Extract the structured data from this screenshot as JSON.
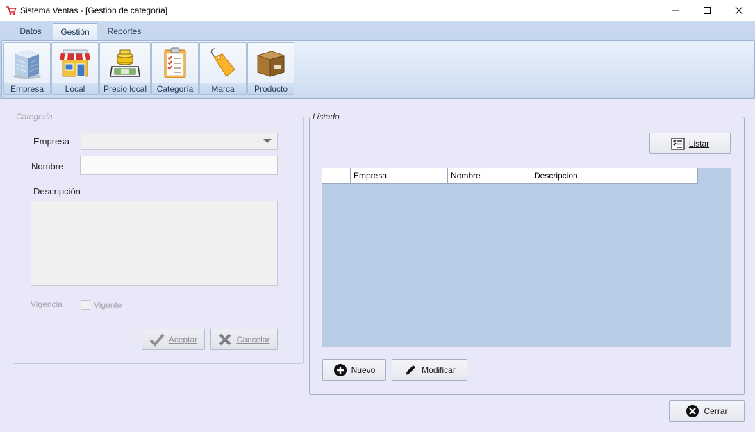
{
  "window": {
    "title": "Sistema Ventas - [Gestión de categoría]",
    "controls": [
      "minimize-icon",
      "maximize-icon",
      "close-icon"
    ]
  },
  "ribbon": {
    "tabs": [
      {
        "label": "Datos",
        "active": false
      },
      {
        "label": "Gestión",
        "active": true
      },
      {
        "label": "Reportes",
        "active": false
      }
    ],
    "buttons": [
      {
        "label": "Empresa",
        "icon": "building-icon"
      },
      {
        "label": "Local",
        "icon": "store-icon"
      },
      {
        "label": "Precio local",
        "icon": "price-cash-icon"
      },
      {
        "label": "Categoría",
        "icon": "clipboard-checklist-icon"
      },
      {
        "label": "Marca",
        "icon": "tag-icon"
      },
      {
        "label": "Producto",
        "icon": "box-icon"
      }
    ]
  },
  "categoria": {
    "legend": "Categoría",
    "empresa_label": "Empresa",
    "empresa_value": "",
    "nombre_label": "Nombre",
    "nombre_value": "",
    "descripcion_label": "Descripción",
    "descripcion_value": "",
    "vigencia_label": "Vigencia",
    "vigente_label": "Vigente",
    "vigente_checked": false,
    "aceptar_label": "Aceptar",
    "cancelar_label": "Cancelar"
  },
  "listado": {
    "legend": "Listado",
    "listar_label": "Listar",
    "columns": [
      "",
      "Empresa",
      "Nombre",
      "Descripcion"
    ],
    "rows": [],
    "nuevo_label": "Nuevo",
    "modificar_label": "Modificar"
  },
  "footer": {
    "cerrar_label": "Cerrar"
  },
  "colors": {
    "ribbon": "#c9d8ee",
    "content_bg": "#e8e8f8",
    "grid_bg": "#b9cce5"
  }
}
